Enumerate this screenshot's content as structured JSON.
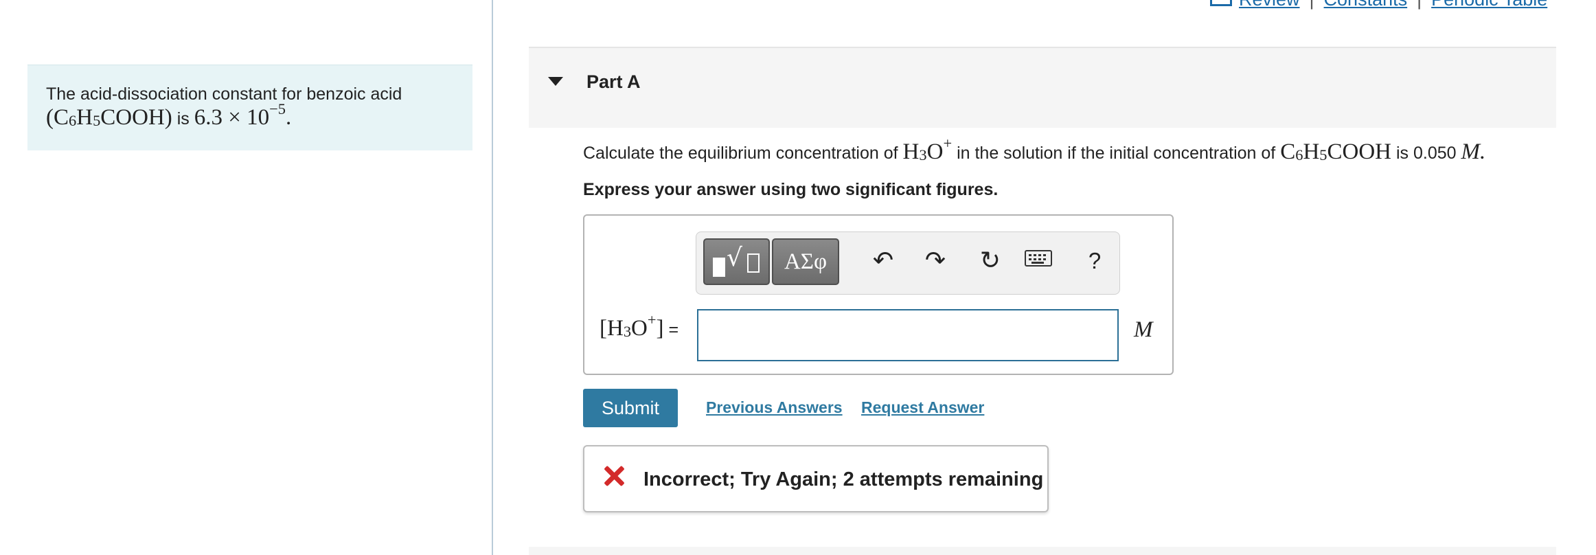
{
  "top_links": {
    "review": "Review",
    "constants": "Constants",
    "periodic_table": "Periodic Table",
    "separator": "|"
  },
  "intro": {
    "line1": "The acid-dissociation constant for benzoic acid",
    "formula": "(C6H5COOH)",
    "is": "is",
    "value": "6.3 × 10−5."
  },
  "part": {
    "title": "Part A"
  },
  "question": {
    "text_before": "Calculate the equilibrium concentration of",
    "species": "H3O+",
    "text_middle": "in the solution if the initial concentration of",
    "acid": "C6H5COOH",
    "text_after": "is 0.050",
    "unit": "M."
  },
  "instruction": "Express your answer using two significant figures.",
  "toolbar": {
    "greek_label": "ΑΣφ",
    "help_label": "?"
  },
  "answer": {
    "label_species": "[H3O+]",
    "equals": "=",
    "value": "",
    "unit": "M"
  },
  "actions": {
    "submit_label": "Submit",
    "previous_answers_label": "Previous Answers",
    "request_answer_label": "Request Answer"
  },
  "feedback": {
    "text": "Incorrect; Try Again; 2 attempts remaining",
    "status_color": "#d32a2a"
  },
  "colors": {
    "accent": "#2f7aa1",
    "intro_bg": "#e7f4f6",
    "input_border": "#2b6f96"
  }
}
